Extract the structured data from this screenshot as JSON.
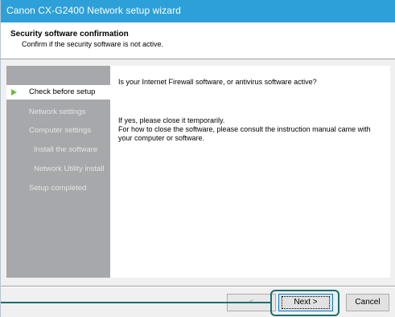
{
  "window": {
    "title": "Canon CX-G2400 Network setup wizard"
  },
  "header": {
    "title": "Security software confirmation",
    "subtitle": "Confirm if the security software is not active."
  },
  "steps": [
    {
      "label": "Check before setup",
      "active": true
    },
    {
      "label": "Network settings",
      "active": false
    },
    {
      "label": "Computer settings",
      "active": false
    },
    {
      "label": "Install the software",
      "active": false
    },
    {
      "label": "Network Utility install",
      "active": false
    },
    {
      "label": "Setup completed",
      "active": false
    }
  ],
  "content": {
    "question": "Is your Internet Firewall software, or antivirus software active?",
    "instruction_line1": "If yes, please close it temporarily.",
    "instruction_line2": "For how to close the software, please consult the instruction manual came with",
    "instruction_line3": "your computer or software."
  },
  "buttons": {
    "back_label": "<",
    "next_label": "Next >",
    "cancel_label": "Cancel"
  },
  "colors": {
    "titlebar": "#2ea0d9",
    "sidebar": "#a7a8ab",
    "active_arrow": "#6dbd3b",
    "callout": "#1b6f6b"
  }
}
